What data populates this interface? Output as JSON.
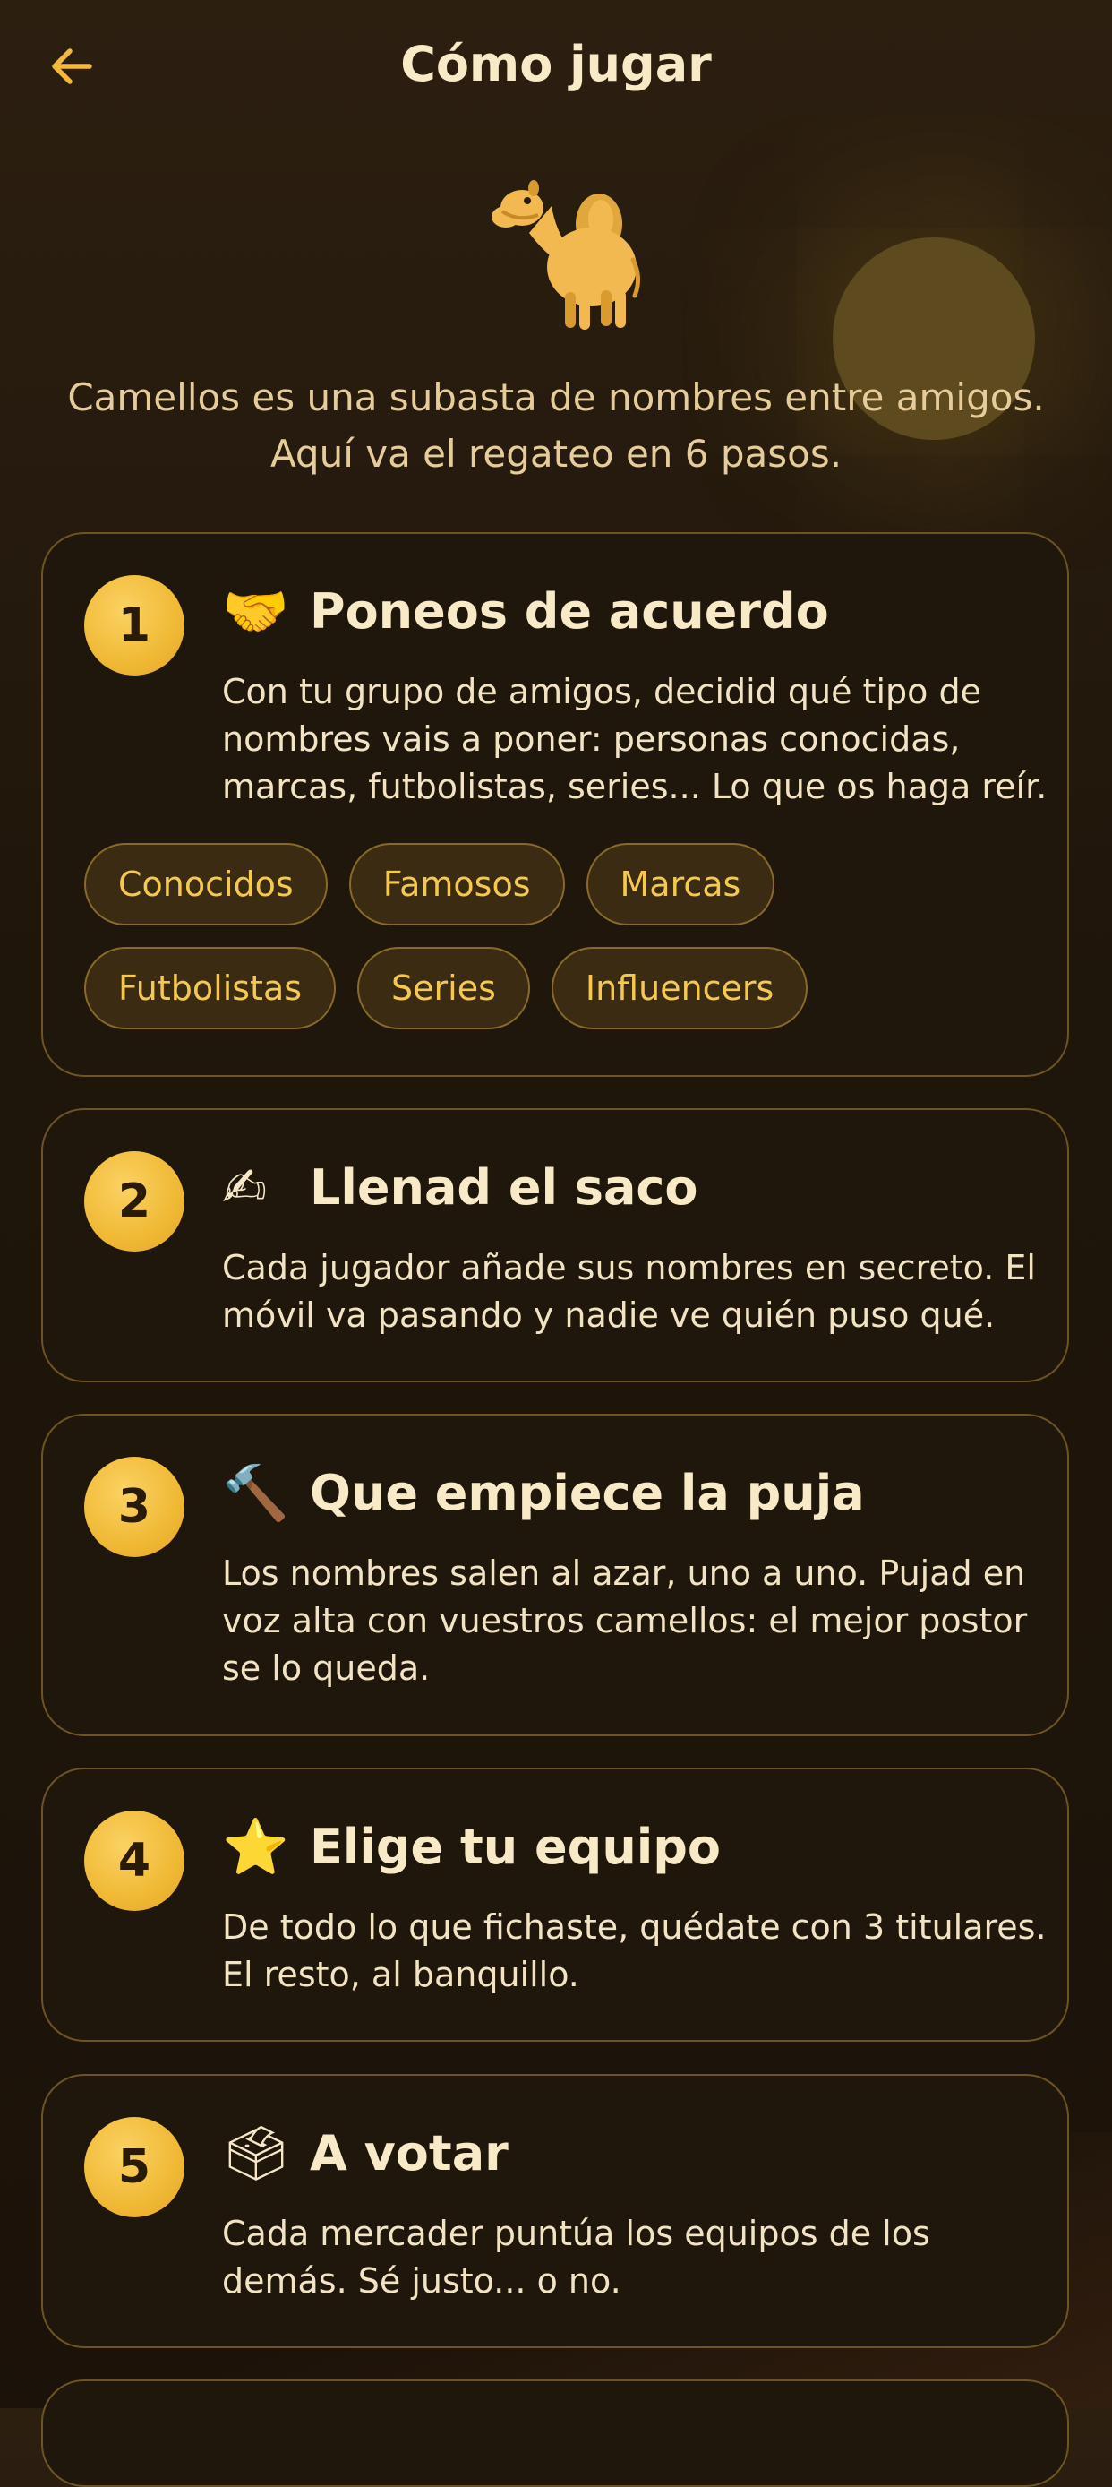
{
  "header": {
    "title": "Cómo jugar",
    "back_icon": "arrow-left-icon"
  },
  "hero": {
    "icon": "camel-icon"
  },
  "intro": "Camellos es una subasta de nombres entre amigos. Aquí va el regateo en 6 pasos.",
  "colors": {
    "accent": "#f0b935",
    "chip_text": "#f5c94f",
    "card_border": "#6e5423",
    "background": "#1f160b"
  },
  "steps": [
    {
      "number": "1",
      "emoji": "🤝",
      "title": "Poneos de acuerdo",
      "description": "Con tu grupo de amigos, decidid qué tipo de nombres vais a poner: personas conocidas, marcas, futbolistas, series... Lo que os haga reír.",
      "chips": [
        "Conocidos",
        "Famosos",
        "Marcas",
        "Futbolistas",
        "Series",
        "Influencers"
      ]
    },
    {
      "number": "2",
      "emoji": "✍",
      "title": "Llenad el saco",
      "description": "Cada jugador añade sus nombres en secreto. El móvil va pasando y nadie ve quién puso qué."
    },
    {
      "number": "3",
      "emoji": "🔨",
      "title": "Que empiece la puja",
      "description": "Los nombres salen al azar, uno a uno. Pujad en voz alta con vuestros camellos: el mejor postor se lo queda."
    },
    {
      "number": "4",
      "emoji": "⭐",
      "title": "Elige tu equipo",
      "description": "De todo lo que fichaste, quédate con 3 titulares. El resto, al banquillo."
    },
    {
      "number": "5",
      "emoji": "🗳",
      "title": "A votar",
      "description": "Cada mercader puntúa los equipos de los demás. Sé justo... o no."
    }
  ]
}
